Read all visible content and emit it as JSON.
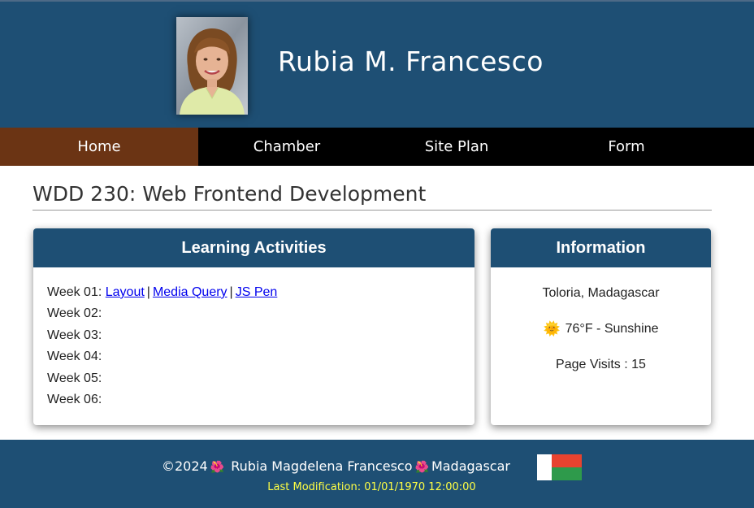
{
  "header": {
    "name": "Rubia M. Francesco",
    "portrait_alt": "profile photo"
  },
  "nav": {
    "items": [
      {
        "label": "Home",
        "active": true
      },
      {
        "label": "Chamber",
        "active": false
      },
      {
        "label": "Site Plan",
        "active": false
      },
      {
        "label": "Form",
        "active": false
      }
    ]
  },
  "main": {
    "heading": "WDD 230: Web Frontend Development"
  },
  "activities": {
    "title": "Learning Activities",
    "weeks": [
      {
        "label": "Week 01:",
        "links": [
          "Layout",
          "Media Query",
          "JS Pen"
        ]
      },
      {
        "label": "Week 02:",
        "links": []
      },
      {
        "label": "Week 03:",
        "links": []
      },
      {
        "label": "Week 04:",
        "links": []
      },
      {
        "label": "Week 05:",
        "links": []
      },
      {
        "label": "Week 06:",
        "links": []
      }
    ],
    "link_separator": "|"
  },
  "information": {
    "title": "Information",
    "location": "Toloria, Madagascar",
    "weather_icon": "🌞",
    "weather": "76°F - Sunshine",
    "page_visits": "Page Visits : 15"
  },
  "footer": {
    "copyright": "©2024",
    "flower_icon": "🌺",
    "full_name": "Rubia Magdelena Francesco",
    "country": "Madagascar",
    "last_modification": "Last Modification: 01/01/1970 12:00:00"
  },
  "colors": {
    "primary": "#1e4f74",
    "nav_active": "#6b3414",
    "nav_bg": "#000000",
    "link": "#0000ee",
    "footer_accent": "#ffff44"
  }
}
